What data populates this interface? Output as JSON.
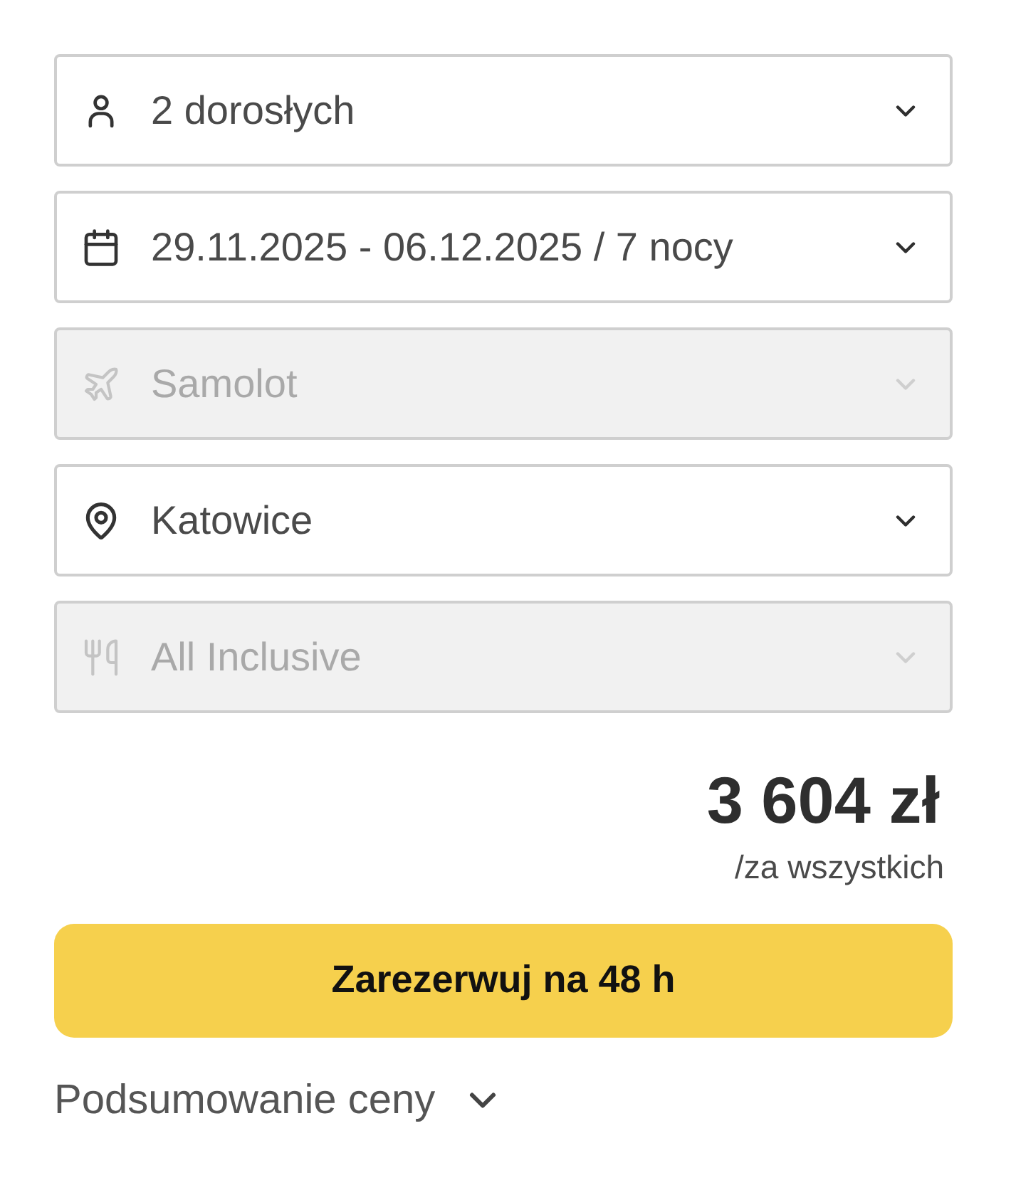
{
  "fields": [
    {
      "kind": "person",
      "value": "2 dorosłych",
      "disabled": false
    },
    {
      "kind": "calendar",
      "value": "29.11.2025 - 06.12.2025 / 7 nocy",
      "disabled": false
    },
    {
      "kind": "plane",
      "value": "Samolot",
      "disabled": true
    },
    {
      "kind": "pin",
      "value": "Katowice",
      "disabled": false
    },
    {
      "kind": "meal",
      "value": "All Inclusive",
      "disabled": true
    }
  ],
  "price": {
    "amount": "3 604 zł",
    "note": "/za wszystkich"
  },
  "book_button": {
    "label": "Zarezerwuj na 48 h"
  },
  "summary_toggle": {
    "label": "Podsumowanie ceny",
    "expanded": false
  }
}
